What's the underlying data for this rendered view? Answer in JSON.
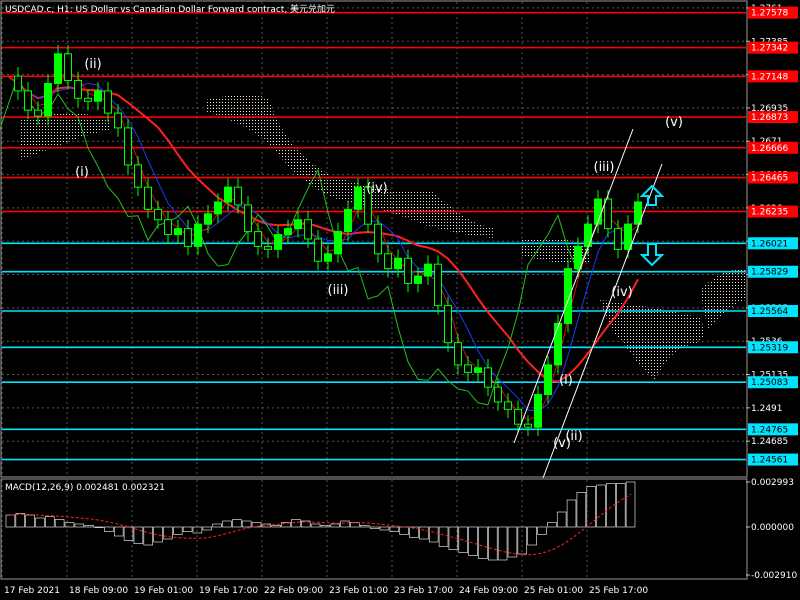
{
  "header": {
    "title": "USDCAD.c, H1:  US Dollar vs Canadian Dollar Forward contract, 美元兑加元"
  },
  "indicator": {
    "label": "MACD(12,26,9) 0.002481 0.002321",
    "axis_ticks": [
      "0.002993",
      "0.000000",
      "-0.002910"
    ]
  },
  "colors": {
    "background": "#000000",
    "grid": "#555555",
    "bull_candle": "#00ff00",
    "bear_candle": "#00ff00",
    "red_level": "#ff0000",
    "cyan_level": "#00e5ff",
    "ma_red": "#ff2020",
    "ma_blue": "#1a3cff",
    "chikou_green": "#22c022",
    "channel": "#ffffff",
    "arrow": "#00e5ff"
  },
  "chart_data": {
    "type": "candlestick",
    "symbol": "USDCAD.c",
    "timeframe": "H1",
    "ylim": [
      1.2445,
      1.2765
    ],
    "x_ticks": [
      "17 Feb 2021",
      "18 Feb 09:00",
      "19 Feb 01:00",
      "19 Feb 17:00",
      "22 Feb 09:00",
      "23 Feb 01:00",
      "23 Feb 17:00",
      "24 Feb 09:00",
      "25 Feb 01:00",
      "25 Feb 17:00"
    ],
    "y_ticks": [
      1.2761,
      1.27385,
      1.2716,
      1.26935,
      1.2671,
      1.26485,
      1.2626,
      1.26035,
      1.2581,
      1.25585,
      1.2536,
      1.25135,
      1.2491,
      1.24685
    ],
    "levels": [
      {
        "value": "1.27578",
        "color": "red"
      },
      {
        "value": "1.27342",
        "color": "red"
      },
      {
        "value": "1.27148",
        "color": "red"
      },
      {
        "value": "1.26873",
        "color": "red"
      },
      {
        "value": "1.26666",
        "color": "red"
      },
      {
        "value": "1.26465",
        "color": "red"
      },
      {
        "value": "1.26235",
        "color": "red"
      },
      {
        "value": "1.26021",
        "color": "cyan"
      },
      {
        "value": "1.25829",
        "color": "cyan"
      },
      {
        "value": "1.25564",
        "color": "cyan"
      },
      {
        "value": "1.25319",
        "color": "cyan"
      },
      {
        "value": "1.25083",
        "color": "cyan"
      },
      {
        "value": "1.24765",
        "color": "cyan"
      },
      {
        "value": "1.24561",
        "color": "cyan"
      }
    ],
    "price_path": [
      1.2715,
      1.2705,
      1.2692,
      1.2688,
      1.271,
      1.273,
      1.2712,
      1.27,
      1.2698,
      1.2705,
      1.269,
      1.268,
      1.2655,
      1.264,
      1.2625,
      1.2618,
      1.2608,
      1.2612,
      1.26,
      1.2615,
      1.2622,
      1.263,
      1.264,
      1.2628,
      1.261,
      1.26,
      1.2598,
      1.2608,
      1.2612,
      1.2618,
      1.2605,
      1.259,
      1.2595,
      1.261,
      1.2625,
      1.264,
      1.2615,
      1.2595,
      1.2585,
      1.2592,
      1.2575,
      1.258,
      1.2588,
      1.256,
      1.2535,
      1.252,
      1.2515,
      1.2518,
      1.2505,
      1.2495,
      1.249,
      1.248,
      1.2478,
      1.25,
      1.252,
      1.2548,
      1.2585,
      1.26,
      1.2615,
      1.2632,
      1.2612,
      1.2598,
      1.2615,
      1.263
    ],
    "macd_hist": [
      0.0008,
      0.0009,
      0.0008,
      0.0006,
      0.0007,
      0.0005,
      0.0003,
      0.0002,
      0.0001,
      0.0,
      -0.0003,
      -0.0006,
      -0.0009,
      -0.0011,
      -0.0012,
      -0.001,
      -0.0008,
      -0.0005,
      -0.0003,
      -0.0004,
      -0.0002,
      0.0002,
      0.0004,
      0.0005,
      0.0004,
      0.0003,
      0.0002,
      0.0001,
      0.0003,
      0.0005,
      0.0004,
      0.0002,
      0.0001,
      0.0002,
      0.0004,
      0.0003,
      0.0001,
      -0.0001,
      -0.0002,
      -0.0003,
      -0.0005,
      -0.0007,
      -0.0008,
      -0.001,
      -0.0013,
      -0.0015,
      -0.0017,
      -0.0019,
      -0.0021,
      -0.0022,
      -0.0022,
      -0.002,
      -0.0018,
      -0.0012,
      -0.0005,
      0.0003,
      0.001,
      0.0018,
      0.0023,
      0.0027,
      0.0028,
      0.0029,
      0.0029,
      0.003
    ],
    "wave_labels": [
      "(ii)",
      "(i)",
      "(iv)",
      "(iii)",
      "(iii)",
      "(v)",
      "(iv)",
      "(i)",
      "(v)",
      "(ii)"
    ]
  }
}
